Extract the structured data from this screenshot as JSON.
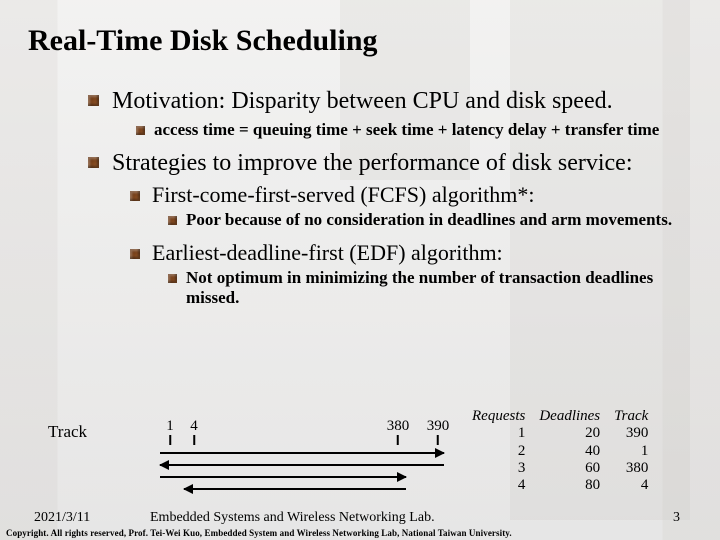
{
  "title": "Real-Time Disk Scheduling",
  "bullets": {
    "motivation": "Motivation: Disparity between CPU and disk speed.",
    "access_eq": "access time = queuing time + seek time + latency delay + transfer time",
    "strategies": "Strategies to improve the performance of disk service:",
    "fcfs": "First-come-first-served (FCFS) algorithm*:",
    "fcfs_sub": "Poor because of no consideration in deadlines and arm movements.",
    "edf": "Earliest-deadline-first (EDF) algorithm:",
    "edf_sub": "Not optimum in minimizing the number of transaction deadlines missed."
  },
  "diagram": {
    "track_label": "Track",
    "ticks": {
      "t1": "1",
      "t4": "4",
      "t380": "380",
      "t390": "390"
    },
    "table": {
      "headers": {
        "requests": "Requests",
        "deadlines": "Deadlines",
        "track": "Track"
      },
      "rows": [
        {
          "req": "1",
          "deadline": "20",
          "track": "390"
        },
        {
          "req": "2",
          "deadline": "40",
          "track": "1"
        },
        {
          "req": "3",
          "deadline": "60",
          "track": "380"
        },
        {
          "req": "4",
          "deadline": "80",
          "track": "4"
        }
      ]
    }
  },
  "footer": {
    "date": "2021/3/11",
    "center": "Embedded Systems and Wireless Networking Lab.",
    "page": "3",
    "copyright": "Copyright. All rights reserved, Prof. Tei-Wei Kuo, Embedded System and Wireless Networking Lab, National Taiwan University."
  }
}
